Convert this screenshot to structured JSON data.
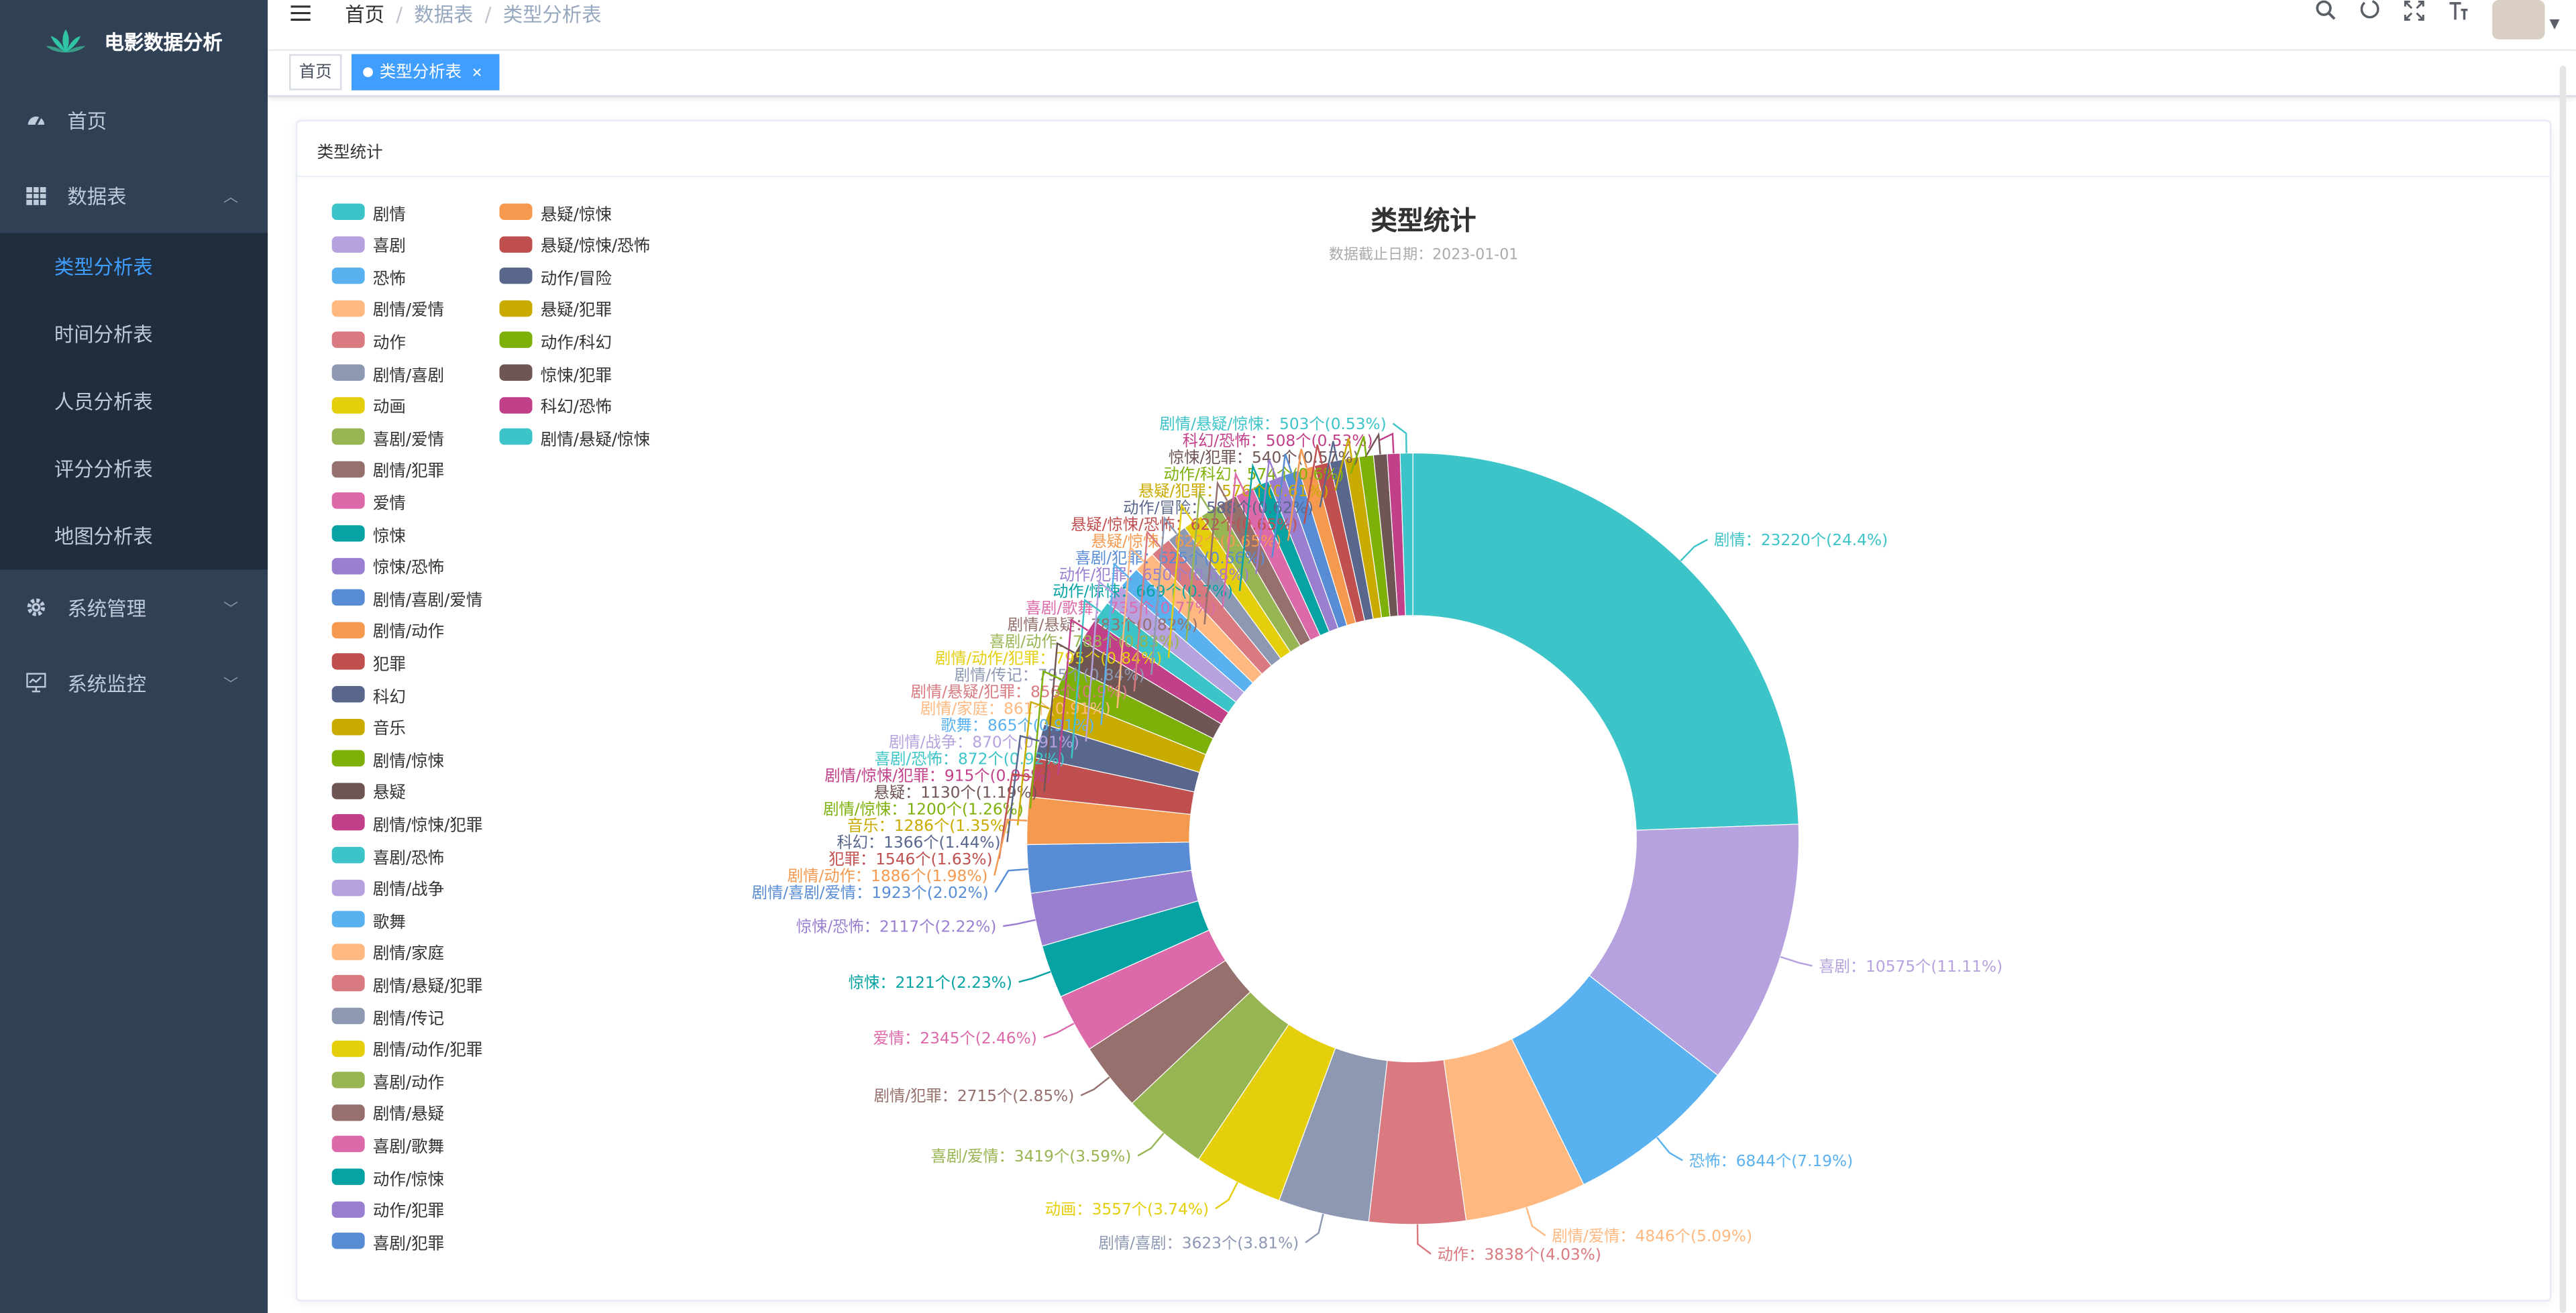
{
  "sidebar": {
    "app_title": "电影数据分析",
    "menu": [
      {
        "label": "首页",
        "icon": "dashboard-icon"
      },
      {
        "label": "数据表",
        "icon": "table-icon",
        "expanded": true,
        "children": [
          "类型分析表",
          "时间分析表",
          "人员分析表",
          "评分分析表",
          "地图分析表"
        ],
        "active_child": "类型分析表"
      },
      {
        "label": "系统管理",
        "icon": "gear-icon"
      },
      {
        "label": "系统监控",
        "icon": "monitor-icon"
      }
    ]
  },
  "header": {
    "breadcrumb": [
      "首页",
      "数据表",
      "类型分析表"
    ],
    "icons": [
      "search-icon",
      "github-icon",
      "fullscreen-icon",
      "font-size-icon",
      "avatar",
      "caret-down-icon"
    ]
  },
  "tags": [
    {
      "label": "首页",
      "active": false
    },
    {
      "label": "类型分析表",
      "active": true
    }
  ],
  "card": {
    "header": "类型统计"
  },
  "chart_data": {
    "type": "pie",
    "donut": true,
    "title": "类型统计",
    "subtitle": "数据截止日期：2023-01-01",
    "legend_position": "left",
    "unit": "个",
    "slices": [
      {
        "name": "剧情",
        "value": 23220,
        "percent": 24.4,
        "color": "#3cc4c8"
      },
      {
        "name": "喜剧",
        "value": 10575,
        "percent": 11.11,
        "color": "#b6a2de"
      },
      {
        "name": "恐怖",
        "value": 6844,
        "percent": 7.19,
        "color": "#5ab1ef"
      },
      {
        "name": "剧情/爱情",
        "value": 4846,
        "percent": 5.09,
        "color": "#ffb980"
      },
      {
        "name": "动作",
        "value": 3838,
        "percent": 4.03,
        "color": "#d87a80"
      },
      {
        "name": "剧情/喜剧",
        "value": 3623,
        "percent": 3.81,
        "color": "#8d98b3"
      },
      {
        "name": "动画",
        "value": 3557,
        "percent": 3.74,
        "color": "#e5cf0d"
      },
      {
        "name": "喜剧/爱情",
        "value": 3419,
        "percent": 3.59,
        "color": "#97b552"
      },
      {
        "name": "剧情/犯罪",
        "value": 2715,
        "percent": 2.85,
        "color": "#95706d"
      },
      {
        "name": "爱情",
        "value": 2345,
        "percent": 2.46,
        "color": "#dc69aa"
      },
      {
        "name": "惊悚",
        "value": 2121,
        "percent": 2.23,
        "color": "#07a2a4"
      },
      {
        "name": "惊悚/恐怖",
        "value": 2117,
        "percent": 2.22,
        "color": "#9a7fd1"
      },
      {
        "name": "剧情/喜剧/爱情",
        "value": 1923,
        "percent": 2.02,
        "color": "#588dd5"
      },
      {
        "name": "剧情/动作",
        "value": 1886,
        "percent": 1.98,
        "color": "#f5994e"
      },
      {
        "name": "犯罪",
        "value": 1546,
        "percent": 1.63,
        "color": "#c05050"
      },
      {
        "name": "科幻",
        "value": 1366,
        "percent": 1.44,
        "color": "#59678c"
      },
      {
        "name": "音乐",
        "value": 1286,
        "percent": 1.35,
        "color": "#c9ab00"
      },
      {
        "name": "剧情/惊悚",
        "value": 1200,
        "percent": 1.26,
        "color": "#7eb00a"
      },
      {
        "name": "悬疑",
        "value": 1130,
        "percent": 1.19,
        "color": "#6f5553"
      },
      {
        "name": "剧情/惊悚/犯罪",
        "value": 915,
        "percent": 0.96,
        "color": "#c14089"
      },
      {
        "name": "喜剧/恐怖",
        "value": 872,
        "percent": 0.92,
        "color": "#3cc4c8"
      },
      {
        "name": "剧情/战争",
        "value": 870,
        "percent": 0.91,
        "color": "#b6a2de"
      },
      {
        "name": "歌舞",
        "value": 865,
        "percent": 0.91,
        "color": "#5ab1ef"
      },
      {
        "name": "剧情/家庭",
        "value": 861,
        "percent": 0.91,
        "color": "#ffb980"
      },
      {
        "name": "剧情/悬疑/犯罪",
        "value": 856,
        "percent": 0.9,
        "color": "#d87a80"
      },
      {
        "name": "剧情/传记",
        "value": 795,
        "percent": 0.84,
        "color": "#8d98b3"
      },
      {
        "name": "剧情/动作/犯罪",
        "value": 795,
        "percent": 0.84,
        "color": "#e5cf0d"
      },
      {
        "name": "喜剧/动作",
        "value": 788,
        "percent": 0.83,
        "color": "#97b552"
      },
      {
        "name": "剧情/悬疑",
        "value": 783,
        "percent": 0.82,
        "color": "#95706d"
      },
      {
        "name": "喜剧/歌舞",
        "value": 735,
        "percent": 0.77,
        "color": "#dc69aa"
      },
      {
        "name": "动作/惊悚",
        "value": 669,
        "percent": 0.7,
        "color": "#07a2a4"
      },
      {
        "name": "动作/犯罪",
        "value": 650,
        "percent": 0.68,
        "color": "#9a7fd1"
      },
      {
        "name": "喜剧/犯罪",
        "value": 625,
        "percent": 0.66,
        "color": "#588dd5"
      },
      {
        "name": "悬疑/惊悚",
        "value": 622,
        "percent": 0.65,
        "color": "#f5994e"
      },
      {
        "name": "悬疑/惊悚/恐怖",
        "value": 622,
        "percent": 0.65,
        "color": "#c05050"
      },
      {
        "name": "动作/冒险",
        "value": 588,
        "percent": 0.62,
        "color": "#59678c"
      },
      {
        "name": "悬疑/犯罪",
        "value": 576,
        "percent": 0.61,
        "color": "#c9ab00"
      },
      {
        "name": "动作/科幻",
        "value": 574,
        "percent": 0.6,
        "color": "#7eb00a"
      },
      {
        "name": "惊悚/犯罪",
        "value": 540,
        "percent": 0.57,
        "color": "#6f5553"
      },
      {
        "name": "科幻/恐怖",
        "value": 508,
        "percent": 0.53,
        "color": "#c14089"
      },
      {
        "name": "剧情/悬疑/惊悚",
        "value": 503,
        "percent": 0.53,
        "color": "#3cc4c8"
      }
    ]
  }
}
